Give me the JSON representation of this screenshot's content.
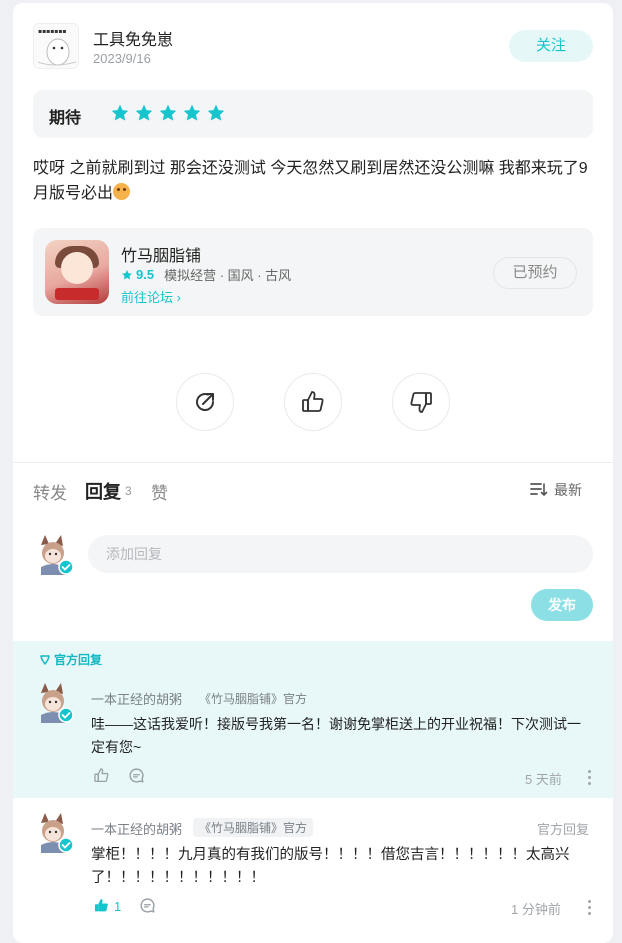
{
  "post": {
    "author_name": "工具免免崽",
    "date": "2023/9/16",
    "follow_label": "关注",
    "rating_label": "期待",
    "rating": 5,
    "text": "哎呀 之前就刷到过 那会还没测试 今天忽然又刷到居然还没公测嘛 我都来玩了9月版号必出",
    "emoji": "smiling-face-emoji"
  },
  "game": {
    "name": "竹马胭脂铺",
    "score": "9.5",
    "tags": "模拟经营 · 国风 · 古风",
    "forum_link": "前往论坛",
    "reserve_label": "已预约"
  },
  "tabs": {
    "repost": "转发",
    "reply": "回复",
    "reply_count": "3",
    "like": "赞",
    "sort_label": "最新"
  },
  "reply_box": {
    "placeholder": "添加回复",
    "publish_label": "发布"
  },
  "official_section": {
    "tag": "官方回复"
  },
  "comments": [
    {
      "author": "一本正经的胡粥",
      "badge": "《竹马胭脂铺》官方",
      "text": "哇——这话我爱听！接版号我第一名！谢谢免掌柜送上的开业祝福！下次测试一定有您~",
      "time": "5 天前"
    },
    {
      "author": "一本正经的胡粥",
      "badge": "《竹马胭脂铺》官方",
      "official_link": "官方回复",
      "text": "掌柜！！！！九月真的有我们的版号！！！！借您吉言！！！！！！太高兴了！！！！！！！！！！！",
      "likes": "1",
      "time": "1 分钟前"
    }
  ],
  "colors": {
    "accent": "#15c5ce",
    "official_bg": "#e8f8f9",
    "card_bg": "#f4f5f6"
  }
}
